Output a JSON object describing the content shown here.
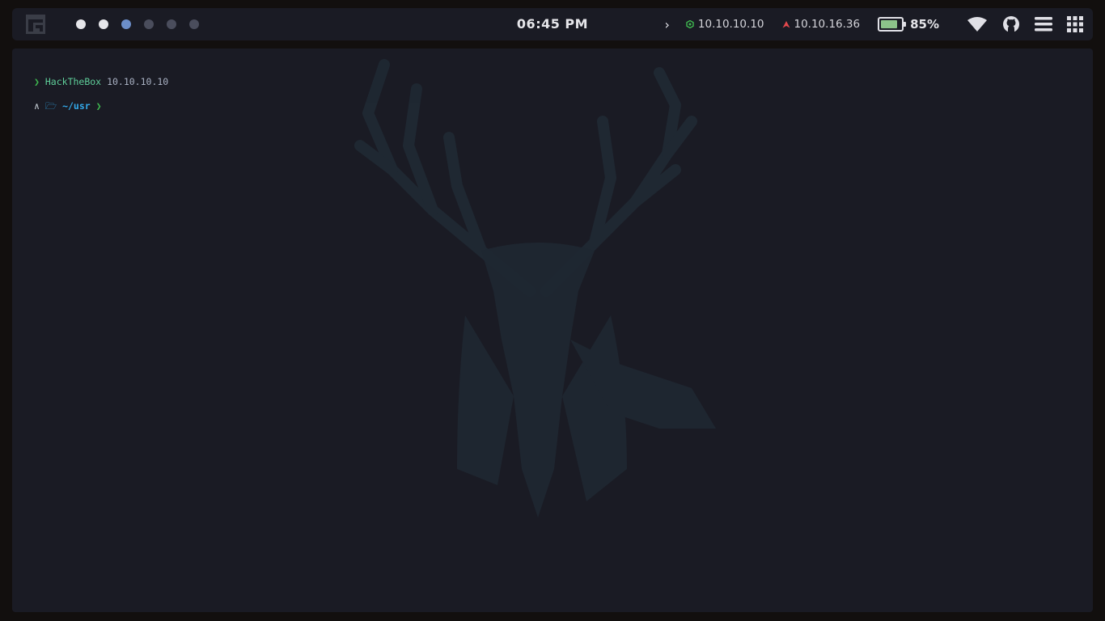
{
  "topbar": {
    "workspaces": [
      {
        "state": "occupied"
      },
      {
        "state": "occupied"
      },
      {
        "state": "active"
      },
      {
        "state": "empty"
      },
      {
        "state": "empty"
      },
      {
        "state": "empty"
      }
    ],
    "clock": "06:45 PM",
    "vpn_ip": "10.10.10.10",
    "target_ip": "10.10.16.36",
    "battery": {
      "percent_label": "85%",
      "level": 0.85
    },
    "icons": [
      "chevron-right-icon",
      "wifi-icon",
      "github-icon",
      "menu-icon",
      "grid-icon"
    ],
    "colors": {
      "active": "#6c8ec9",
      "occupied": "#e6e6ea",
      "empty": "#4a4d5c",
      "vpn": "#3fb950",
      "target": "#e5484d",
      "battery": "#8cc38a"
    }
  },
  "terminal": {
    "line1": {
      "arrow": "❯",
      "host": "HackTheBox",
      "ip": "10.10.10.10"
    },
    "line2": {
      "distro": "∧",
      "folder": "🗁",
      "path": "~/usr",
      "arrow": "❯"
    },
    "colors": {
      "arrow": "#3fb950",
      "host": "#5fcf9a",
      "ip": "#a9b1c3",
      "path": "#33a8e8"
    }
  }
}
